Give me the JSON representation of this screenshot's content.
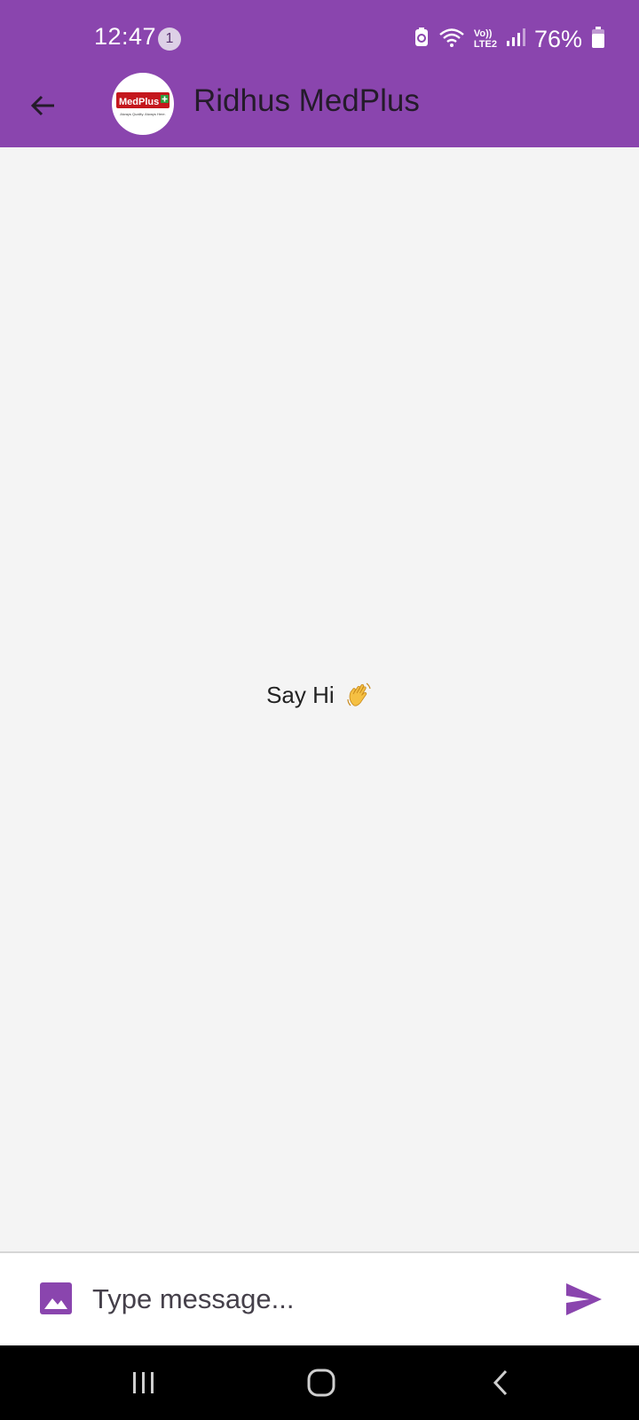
{
  "status_bar": {
    "time": "12:47",
    "notification_count": "1",
    "network_label": "LTE2",
    "volte_label": "Vo))",
    "battery_percent": "76%"
  },
  "header": {
    "title": "Ridhus MedPlus",
    "avatar_logo_text": "MedPlus",
    "avatar_tagline": "Always Quality. Always Here.",
    "background_color": "#8a45ae"
  },
  "chat": {
    "empty_hint": "Say Hi",
    "empty_hint_icon": "waving-hand-icon"
  },
  "composer": {
    "placeholder": "Type message...",
    "attach_icon": "image-icon",
    "send_icon": "send-icon",
    "accent_color": "#8a45ae"
  },
  "navigation": {
    "recents_icon": "recents-icon",
    "home_icon": "home-icon",
    "back_icon": "back-chevron-icon"
  }
}
